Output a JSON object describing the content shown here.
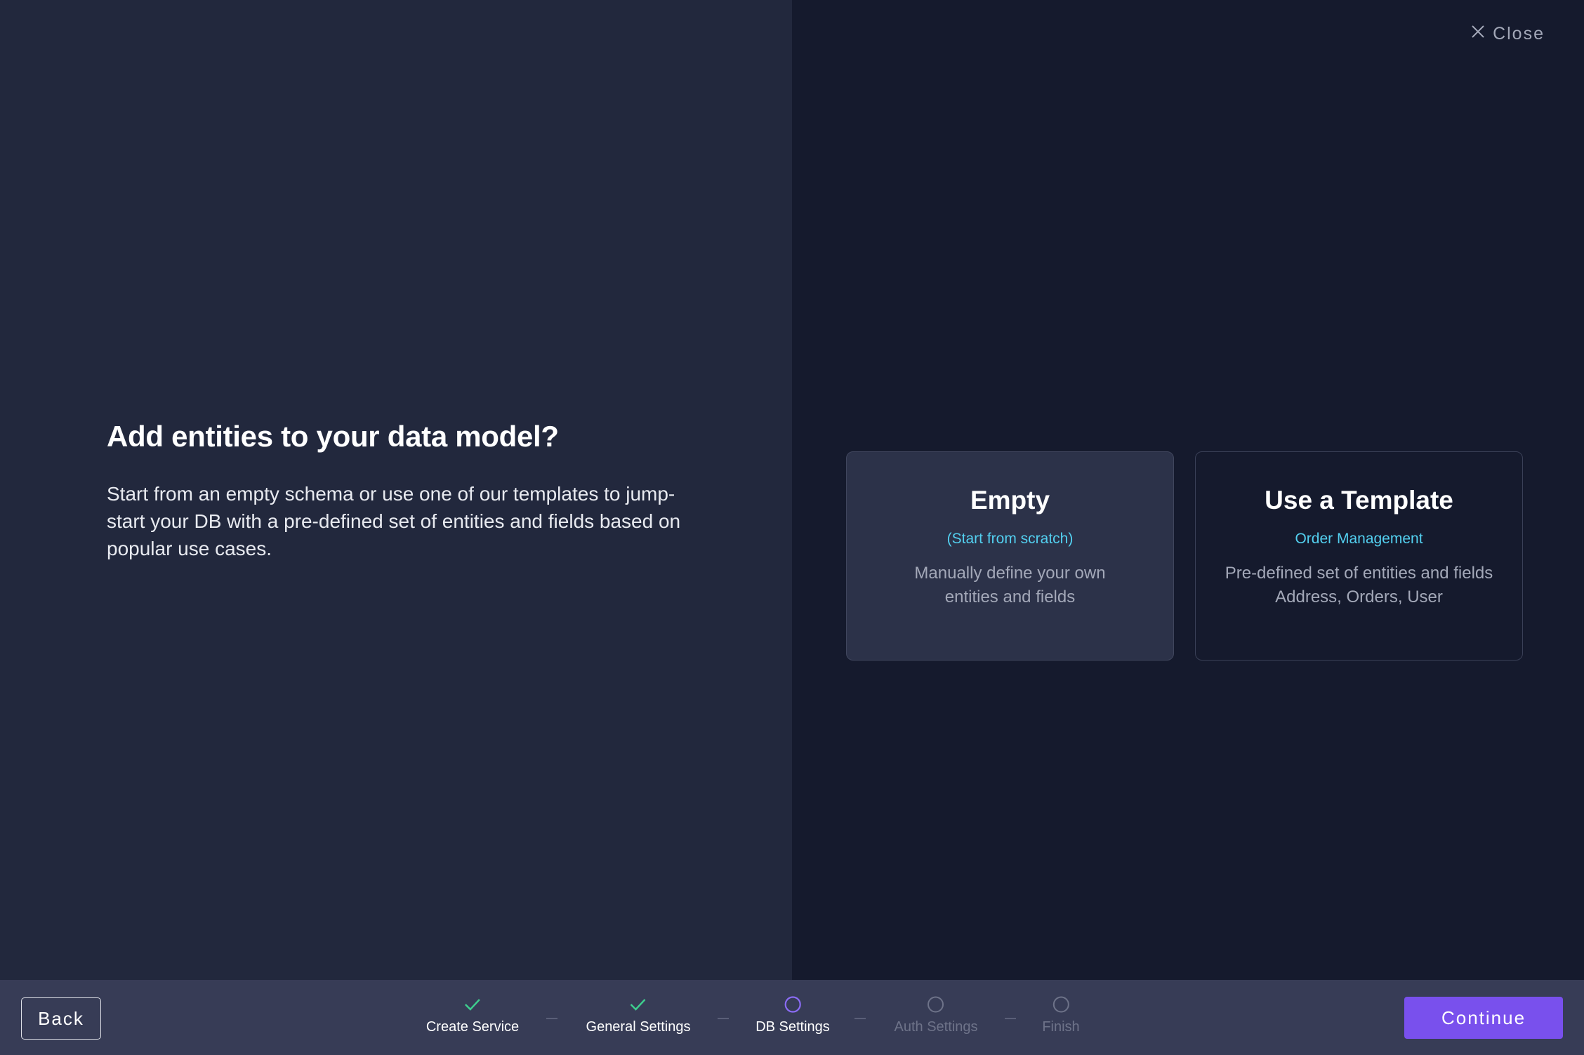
{
  "header": {
    "close_label": "Close"
  },
  "intro": {
    "title": "Add entities to your data model?",
    "description": "Start from an empty schema or use one of our templates to jump-start your DB with a pre-defined set of entities and fields based on popular use cases."
  },
  "options": [
    {
      "title": "Empty",
      "subtitle": "(Start from scratch)",
      "description_line1": "Manually define your own",
      "description_line2": "entities and fields",
      "selected": true
    },
    {
      "title": "Use a Template",
      "subtitle": "Order Management",
      "description_line1": "Pre-defined set of entities and fields",
      "description_line2": "Address, Orders, User",
      "selected": false
    }
  ],
  "footer": {
    "back_label": "Back",
    "continue_label": "Continue",
    "steps": [
      {
        "label": "Create Service",
        "status": "done"
      },
      {
        "label": "General Settings",
        "status": "done"
      },
      {
        "label": "DB Settings",
        "status": "current"
      },
      {
        "label": "Auth Settings",
        "status": "pending"
      },
      {
        "label": "Finish",
        "status": "pending"
      }
    ]
  },
  "colors": {
    "accent": "#7950ed",
    "check": "#3ecf8e",
    "subtitle": "#53d0f0",
    "current_step": "#8b6cf5"
  }
}
